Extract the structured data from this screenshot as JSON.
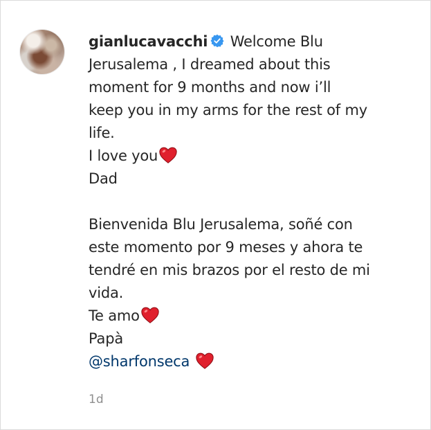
{
  "comment": {
    "username": "gianlucavacchi",
    "verified_icon": "verified-badge-icon",
    "paragraph1_lead": "Welcome Blu\nJerusalema , I dreamed about this\nmoment for 9 months and now i’ll\nkeep you in my arms for the rest of my\nlife.\nI love you",
    "dad": "Dad",
    "paragraph2_lead": "Bienvenida Blu Jerusalema, soñé con\neste momento por 9 meses y ahora te\ntendré en mis brazos por el resto de mi\nvida.\nTe amo",
    "papa": "Papà",
    "mention": "@sharfonseca",
    "heart_icon": "red-heart-emoji-icon",
    "timestamp": "1d"
  },
  "colors": {
    "text": "#262626",
    "mention": "#00376b",
    "muted": "#8e8e8e",
    "verified": "#3897f0",
    "heart": "#e0202d"
  }
}
